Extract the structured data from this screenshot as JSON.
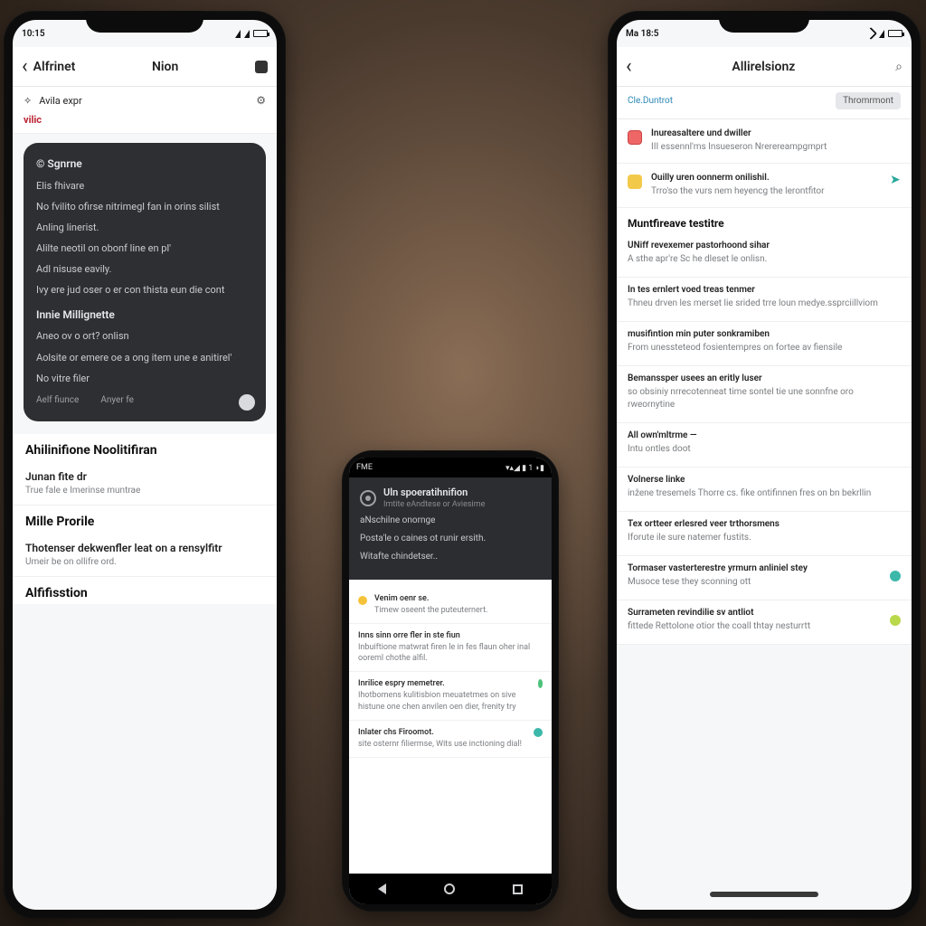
{
  "phoneA": {
    "status": {
      "left": "10:15",
      "time_small": ""
    },
    "appbar": {
      "back": "‹",
      "title_left": "Alfrinet",
      "title_center": "Nion"
    },
    "sub": {
      "icon": "✧",
      "label": "Avila expr",
      "gear": "⚙"
    },
    "tag": "vilic",
    "card": {
      "title": "© Sgnrne",
      "lines": [
        "Elis fhivare",
        "No fvilito ofirse nitrimegl fan in orins silist",
        "Anling linerist.",
        "Alilte neotil on obonf line en pl'",
        "Adl nisuse eavily.",
        "Ivy ere jud oser o er con thista eun die cont"
      ],
      "sub_title": "Innie  Millignette",
      "sub_lines": [
        "Aneo ov o ort?  onlisn",
        "Aolsite or emere oe a ong item une e anitirel'",
        "No vitre filer"
      ],
      "footer_left": "Aelf fiunce",
      "footer_right": "Anyer fe"
    },
    "section1": "Ahilinifione  Noolitifiran",
    "rows1": [
      {
        "title": "Junan fite dr",
        "sub": "True fale e Imerinse muntrae"
      }
    ],
    "section2": "Mille Prorile",
    "rows2": [
      {
        "title": "Thotenser dekwenfler leat on a rensylfitr",
        "sub": "Umeir be on ollifre ord."
      }
    ],
    "section3": "Alfifisstion"
  },
  "phoneB": {
    "status": {
      "left": "FME",
      "right": "▾▴◢ ▮ 1 ◗▮"
    },
    "dark": {
      "headline": "Uln spoeratihnifion",
      "sub": "Imtite eAndtese or Aviesime",
      "p1": "aNschilne onornge",
      "p2": "Posta'le o caines ot runir ersith.",
      "p3": "Witafte chindetser.."
    },
    "items": [
      {
        "bullet": "yellow",
        "title": "Venim oenr se.",
        "sub": "Timew oseent the puteuternert."
      },
      {
        "bullet": "",
        "title": "Inns sinn orre fler in ste fiun",
        "sub": "Inbuiftione matwrat firen le in fes flaun  oher inal ooreml chothe alfil."
      },
      {
        "bullet": "",
        "title": "Inrilice espry memetrer.",
        "sub": "Ihotbomens kulitisbion meuatetmes on sive histune one chen anvilen oen dier, frenity try",
        "side": "green"
      },
      {
        "bullet": "",
        "title": "Inlater chs Firoomot.",
        "sub": "site osternr filiermse,  Wits use inctioning dial!",
        "side": "teal"
      }
    ]
  },
  "phoneC": {
    "status": {
      "left": "Ma 18:5"
    },
    "appbar": {
      "title": "Allirelsionz"
    },
    "sub": {
      "link": "Cle.Duntrot",
      "chip": "Thromrmont"
    },
    "blocks": [
      {
        "icon": "ic-red",
        "title": "Inureasaltere und dwiller",
        "sub": "III essennl'ms Insueseron   Nrerereampgmprt"
      },
      {
        "icon": "ic-yellow",
        "title": "Ouilly uren oonnerm onilishil.",
        "sub": "Trro'so the vurs nem heyencg the lerontfitor",
        "right": "arrow-teal",
        "right_glyph": "➤"
      }
    ],
    "section1": "Muntfireave testitre",
    "rows": [
      {
        "title": "UNiff revexemer pastorhoond sihar",
        "sub": "A sthe apr're Sc he dleset le onlisn."
      },
      {
        "title": "In tes ernlert voed treas tenmer",
        "sub": "Thneu drven les merset lie srided trre loun medye.ssprciillviom"
      },
      {
        "title": "musifintion min puter sonkramiben",
        "sub": "From unessteteod fosientempres on fortee av fiensile"
      },
      {
        "title": "Bemanssper usees an eritly luser",
        "sub": "so obsiniy nrrecotenneat time sontel tie une sonnfne oro rweornytine"
      },
      {
        "title": "All own'mltrme —",
        "sub": "Intu ontles doot"
      },
      {
        "title": "Volnerse linke",
        "sub": "inžene tresemels  Thorre cs. fike ontifinnen fres on bn bekrllin"
      },
      {
        "title": "Tex ortteer erlesred veer trthorsmens",
        "sub": "Iforute ile sure natemer fustits."
      },
      {
        "title": "Tormaser vasterterestre yrmurn anliniel stey",
        "sub": "Musoce tese they sconning ott",
        "dot": "teal"
      },
      {
        "title": "Surrameten revindilie sv antliot",
        "sub": "fittede Rettolone otior  the coall thtay nesturrtt",
        "dot": "lime"
      }
    ]
  }
}
